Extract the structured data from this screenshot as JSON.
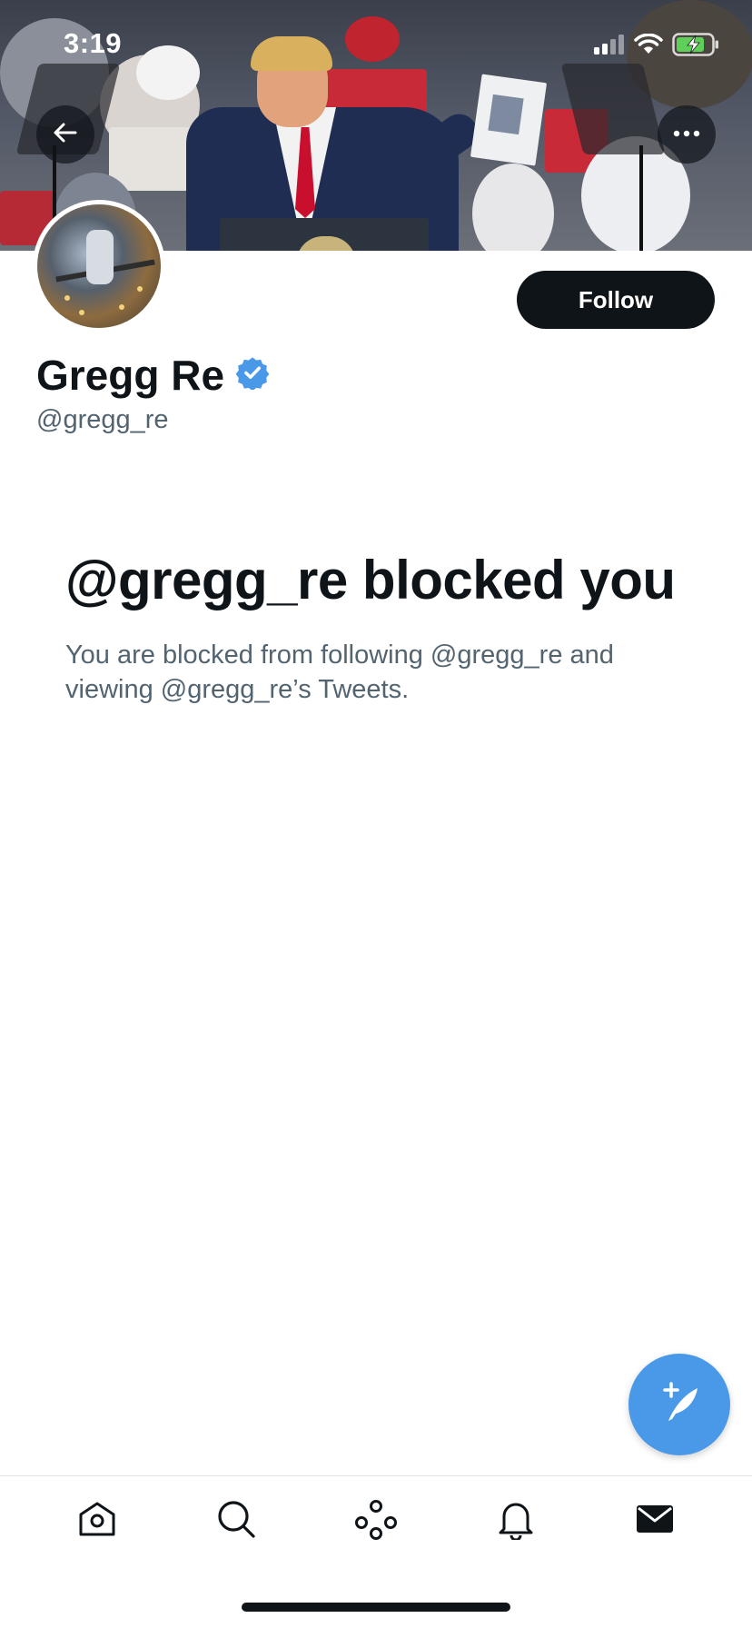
{
  "status_bar": {
    "time": "3:19",
    "icons": [
      "signal-icon",
      "wifi-icon",
      "battery-charging-icon"
    ]
  },
  "banner": {
    "back_icon": "arrow-left-icon",
    "more_icon": "more-horizontal-icon"
  },
  "profile": {
    "display_name": "Gregg Re",
    "handle": "@gregg_re",
    "verified_icon": "verified-badge-icon",
    "follow_label": "Follow"
  },
  "blocked": {
    "title": "@gregg_re blocked you",
    "message": "You are blocked from following @gregg_re and viewing @gregg_re’s Tweets."
  },
  "fab": {
    "icon": "compose-tweet-icon"
  },
  "bottom_nav": [
    {
      "name": "home",
      "icon": "home-icon"
    },
    {
      "name": "search",
      "icon": "search-icon"
    },
    {
      "name": "spaces",
      "icon": "spaces-icon"
    },
    {
      "name": "notifications",
      "icon": "bell-icon"
    },
    {
      "name": "messages",
      "icon": "mail-icon"
    }
  ],
  "colors": {
    "accent": "#4a99e9",
    "text_primary": "#0f1419",
    "text_secondary": "#536471",
    "verified": "#4a99e9"
  }
}
